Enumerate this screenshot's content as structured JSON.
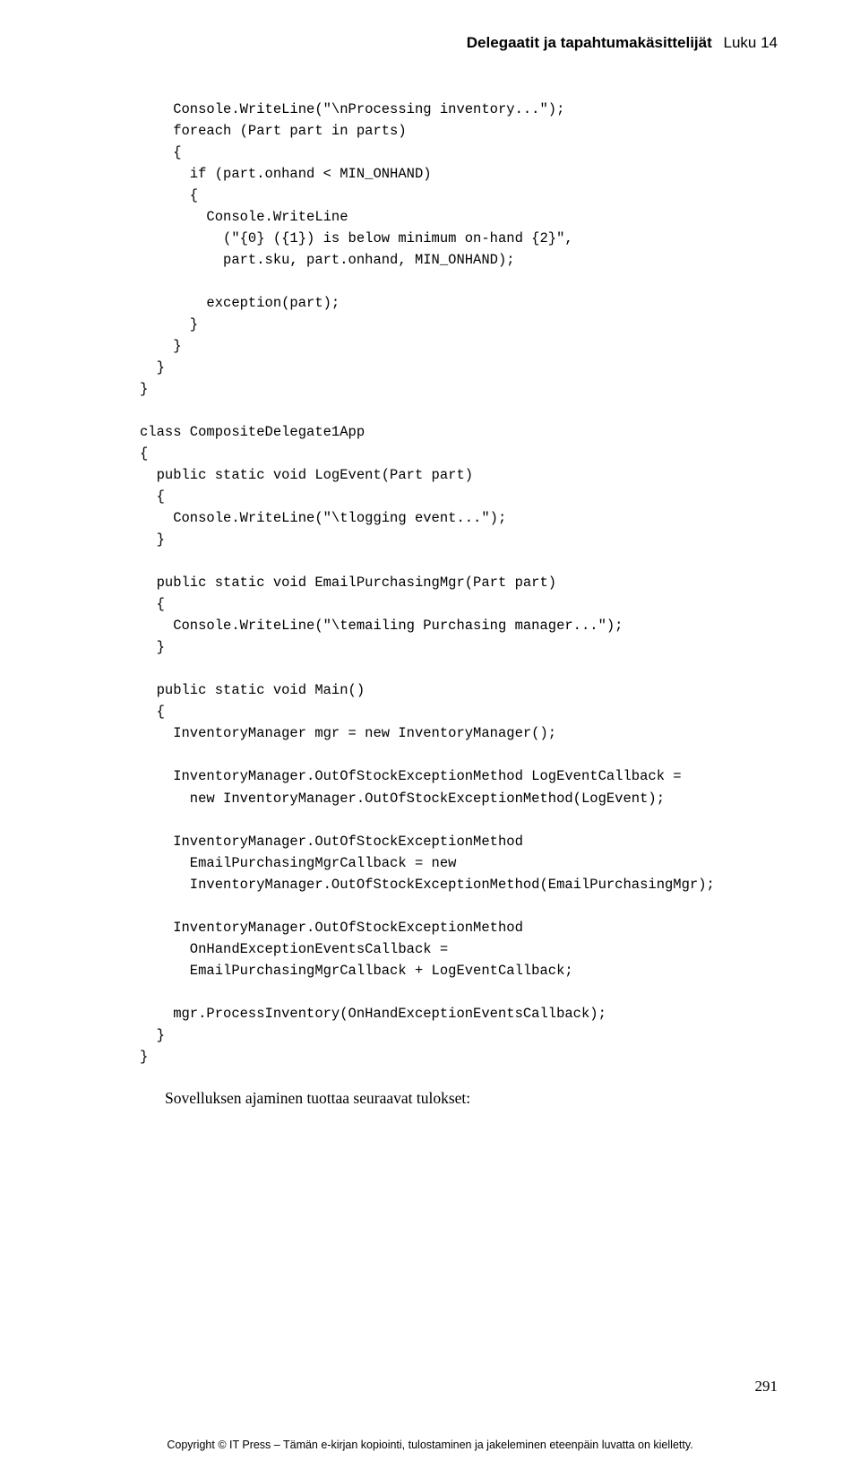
{
  "header": {
    "left": "Delegaatit ja tapahtumakäsittelijät",
    "right": "Luku 14"
  },
  "code": "    Console.WriteLine(\"\\nProcessing inventory...\");\n    foreach (Part part in parts)\n    {\n      if (part.onhand < MIN_ONHAND)\n      {\n        Console.WriteLine\n          (\"{0} ({1}) is below minimum on-hand {2}\",\n          part.sku, part.onhand, MIN_ONHAND);\n\n        exception(part);\n      }\n    }\n  }\n}\n\nclass CompositeDelegate1App\n{\n  public static void LogEvent(Part part)\n  {\n    Console.WriteLine(\"\\tlogging event...\");\n  }\n\n  public static void EmailPurchasingMgr(Part part)\n  {\n    Console.WriteLine(\"\\temailing Purchasing manager...\");\n  }\n\n  public static void Main()\n  {\n    InventoryManager mgr = new InventoryManager();\n\n    InventoryManager.OutOfStockExceptionMethod LogEventCallback =\n      new InventoryManager.OutOfStockExceptionMethod(LogEvent);\n\n    InventoryManager.OutOfStockExceptionMethod\n      EmailPurchasingMgrCallback = new\n      InventoryManager.OutOfStockExceptionMethod(EmailPurchasingMgr);\n\n    InventoryManager.OutOfStockExceptionMethod\n      OnHandExceptionEventsCallback =\n      EmailPurchasingMgrCallback + LogEventCallback;\n\n    mgr.ProcessInventory(OnHandExceptionEventsCallback);\n  }\n}",
  "result_line": "Sovelluksen ajaminen tuottaa seuraavat tulokset:",
  "page_number": "291",
  "footer": "Copyright © IT Press – Tämän e-kirjan kopiointi, tulostaminen ja jakeleminen eteenpäin luvatta on kielletty."
}
